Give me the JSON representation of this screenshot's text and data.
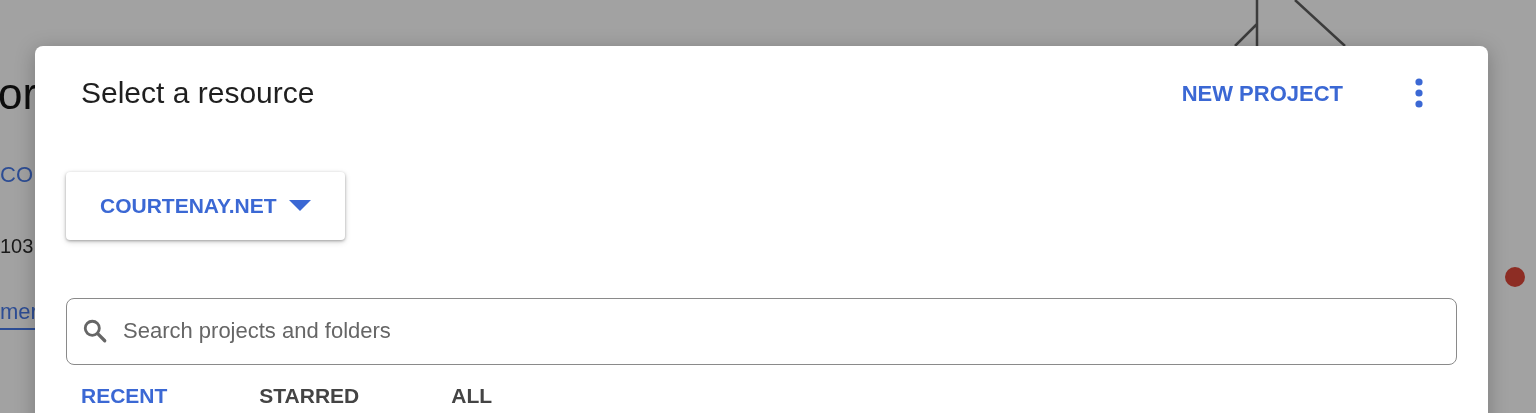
{
  "background": {
    "heading": "or",
    "link": "CO",
    "number": "103",
    "underlined_link": "mer"
  },
  "dialog": {
    "title": "Select a resource",
    "new_project": "NEW PROJECT",
    "organization": "COURTENAY.NET",
    "search": {
      "placeholder": "Search projects and folders"
    },
    "tabs": [
      {
        "label": "RECENT",
        "selected": true
      },
      {
        "label": "STARRED",
        "selected": false
      },
      {
        "label": "ALL",
        "selected": false
      }
    ]
  }
}
